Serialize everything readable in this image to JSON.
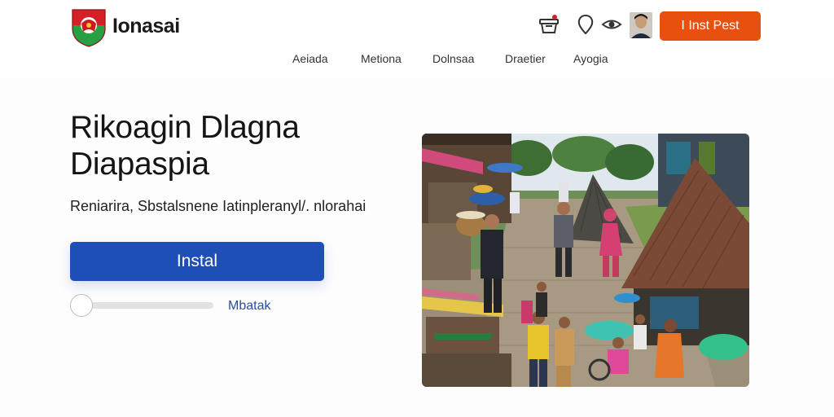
{
  "header": {
    "brand": "Ionasai",
    "nav": [
      "Aeiada",
      "Metiona",
      "Dolnsaa",
      "Draetier",
      "Ayogia"
    ],
    "cta_label": "I Inst Pest",
    "icons": [
      "basket-icon",
      "map-pin-icon",
      "eye-icon",
      "user-avatar"
    ],
    "colors": {
      "cta": "#e8500e",
      "logo_red": "#d42027",
      "logo_green": "#27a043"
    }
  },
  "hero": {
    "title_line1": "Rikoagin Dlagna",
    "title_line2": "Diapaspia",
    "subtitle": "Reniarira, Sbstalsnene Iatinpleranyl/. nlorahai",
    "install_label": "Instal",
    "slider_label": "Mbatak",
    "slider_value": 0.0,
    "colors": {
      "install": "#1e4fb6"
    }
  },
  "image": {
    "subject": "village-market-photo"
  }
}
